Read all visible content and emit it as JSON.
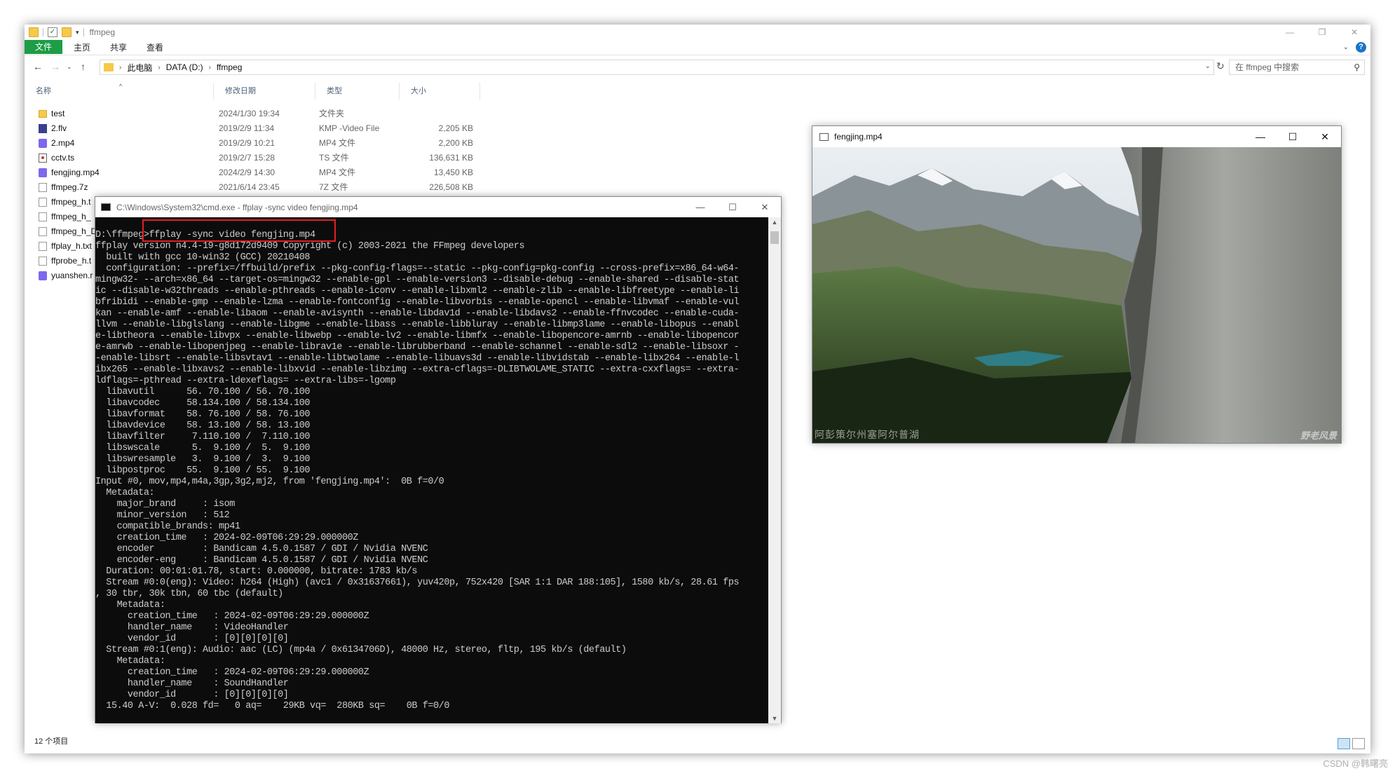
{
  "explorer": {
    "title": "ffmpeg",
    "ribbon_tabs": [
      "文件",
      "主页",
      "共享",
      "查看"
    ],
    "breadcrumb": [
      "此电脑",
      "DATA (D:)",
      "ffmpeg"
    ],
    "search_placeholder": "在 ffmpeg 中搜索",
    "columns": [
      "名称",
      "修改日期",
      "类型",
      "大小"
    ],
    "files": [
      {
        "name": "test",
        "date": "2024/1/30 19:34",
        "type": "文件夹",
        "size": "",
        "icon": "folder-icon"
      },
      {
        "name": "2.flv",
        "date": "2019/2/9 11:34",
        "type": "KMP -Video File",
        "size": "2,205 KB",
        "icon": "flv-file-icon"
      },
      {
        "name": "2.mp4",
        "date": "2019/2/9 10:21",
        "type": "MP4 文件",
        "size": "2,200 KB",
        "icon": "mp4-file-icon"
      },
      {
        "name": "cctv.ts",
        "date": "2019/2/7 15:28",
        "type": "TS 文件",
        "size": "136,631 KB",
        "icon": "ts-file-icon"
      },
      {
        "name": "fengjing.mp4",
        "date": "2024/2/9 14:30",
        "type": "MP4 文件",
        "size": "13,450 KB",
        "icon": "mp4-file-icon"
      },
      {
        "name": "ffmpeg.7z",
        "date": "2021/6/14 23:45",
        "type": "7Z 文件",
        "size": "226,508 KB",
        "icon": "archive-file-icon"
      },
      {
        "name": "ffmpeg_h.t",
        "date": "",
        "type": "",
        "size": "",
        "icon": "text-file-icon"
      },
      {
        "name": "ffmpeg_h_",
        "date": "",
        "type": "",
        "size": "",
        "icon": "text-file-icon"
      },
      {
        "name": "ffmpeg_h_D",
        "date": "",
        "type": "",
        "size": "",
        "icon": "text-file-icon"
      },
      {
        "name": "ffplay_h.txt",
        "date": "",
        "type": "",
        "size": "",
        "icon": "text-file-icon"
      },
      {
        "name": "ffprobe_h.t",
        "date": "",
        "type": "",
        "size": "",
        "icon": "text-file-icon"
      },
      {
        "name": "yuanshen.r",
        "date": "",
        "type": "",
        "size": "",
        "icon": "mp4-file-icon"
      }
    ],
    "status_count": "12 个项目"
  },
  "cmd": {
    "title": "C:\\Windows\\System32\\cmd.exe - ffplay  -sync video fengjing.mp4",
    "lines": [
      "D:\\ffmpeg>ffplay -sync video fengjing.mp4",
      "ffplay version n4.4-19-g8d172d9409 Copyright (c) 2003-2021 the FFmpeg developers",
      "  built with gcc 10-win32 (GCC) 20210408",
      "  configuration: --prefix=/ffbuild/prefix --pkg-config-flags=--static --pkg-config=pkg-config --cross-prefix=x86_64-w64-",
      "mingw32- --arch=x86_64 --target-os=mingw32 --enable-gpl --enable-version3 --disable-debug --enable-shared --disable-stat",
      "ic --disable-w32threads --enable-pthreads --enable-iconv --enable-libxml2 --enable-zlib --enable-libfreetype --enable-li",
      "bfribidi --enable-gmp --enable-lzma --enable-fontconfig --enable-libvorbis --enable-opencl --enable-libvmaf --enable-vul",
      "kan --enable-amf --enable-libaom --enable-avisynth --enable-libdav1d --enable-libdavs2 --enable-ffnvcodec --enable-cuda-",
      "llvm --enable-libglslang --enable-libgme --enable-libass --enable-libbluray --enable-libmp3lame --enable-libopus --enabl",
      "e-libtheora --enable-libvpx --enable-libwebp --enable-lv2 --enable-libmfx --enable-libopencore-amrnb --enable-libopencor",
      "e-amrwb --enable-libopenjpeg --enable-librav1e --enable-librubberband --enable-schannel --enable-sdl2 --enable-libsoxr -",
      "-enable-libsrt --enable-libsvtav1 --enable-libtwolame --enable-libuavs3d --enable-libvidstab --enable-libx264 --enable-l",
      "ibx265 --enable-libxavs2 --enable-libxvid --enable-libzimg --extra-cflags=-DLIBTWOLAME_STATIC --extra-cxxflags= --extra-",
      "ldflags=-pthread --extra-ldexeflags= --extra-libs=-lgomp",
      "  libavutil      56. 70.100 / 56. 70.100",
      "  libavcodec     58.134.100 / 58.134.100",
      "  libavformat    58. 76.100 / 58. 76.100",
      "  libavdevice    58. 13.100 / 58. 13.100",
      "  libavfilter     7.110.100 /  7.110.100",
      "  libswscale      5.  9.100 /  5.  9.100",
      "  libswresample   3.  9.100 /  3.  9.100",
      "  libpostproc    55.  9.100 / 55.  9.100",
      "Input #0, mov,mp4,m4a,3gp,3g2,mj2, from 'fengjing.mp4':  0B f=0/0",
      "  Metadata:",
      "    major_brand     : isom",
      "    minor_version   : 512",
      "    compatible_brands: mp41",
      "    creation_time   : 2024-02-09T06:29:29.000000Z",
      "    encoder         : Bandicam 4.5.0.1587 / GDI / Nvidia NVENC",
      "    encoder-eng     : Bandicam 4.5.0.1587 / GDI / Nvidia NVENC",
      "  Duration: 00:01:01.78, start: 0.000000, bitrate: 1783 kb/s",
      "  Stream #0:0(eng): Video: h264 (High) (avc1 / 0x31637661), yuv420p, 752x420 [SAR 1:1 DAR 188:105], 1580 kb/s, 28.61 fps",
      ", 30 tbr, 30k tbn, 60 tbc (default)",
      "    Metadata:",
      "      creation_time   : 2024-02-09T06:29:29.000000Z",
      "      handler_name    : VideoHandler",
      "      vendor_id       : [0][0][0][0]",
      "  Stream #0:1(eng): Audio: aac (LC) (mp4a / 0x6134706D), 48000 Hz, stereo, fltp, 195 kb/s (default)",
      "    Metadata:",
      "      creation_time   : 2024-02-09T06:29:29.000000Z",
      "      handler_name    : SoundHandler",
      "      vendor_id       : [0][0][0][0]",
      "  15.40 A-V:  0.028 fd=   0 aq=    29KB vq=  280KB sq=    0B f=0/0"
    ]
  },
  "player": {
    "title": "fengjing.mp4",
    "caption_left": "阿彭策尔州塞阿尔普湖",
    "caption_right": "野老风景"
  },
  "watermark": "CSDN @韩曙亮"
}
